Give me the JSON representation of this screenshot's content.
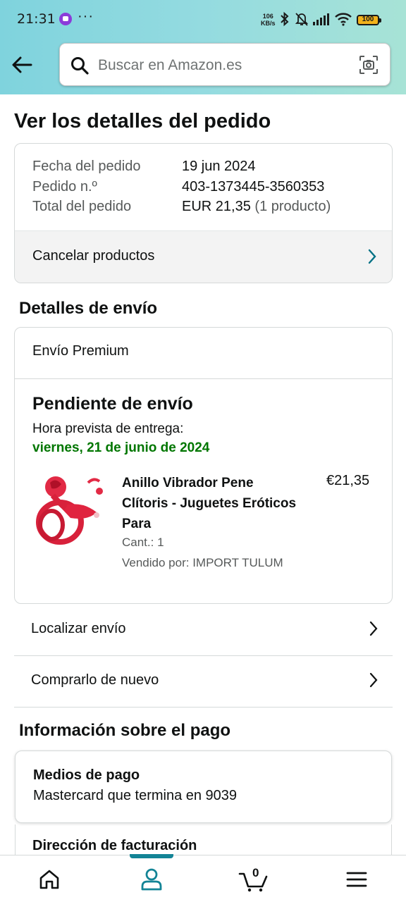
{
  "status_bar": {
    "time": "21:31",
    "more": "···",
    "speed_value": "106",
    "speed_unit": "KB/s",
    "battery": "100"
  },
  "search": {
    "placeholder": "Buscar en Amazon.es"
  },
  "page": {
    "title": "Ver los detalles del pedido"
  },
  "order": {
    "date_label": "Fecha del pedido",
    "date_value": "19 jun 2024",
    "number_label": "Pedido n.º",
    "number_value": "403-1373445-3560353",
    "total_label": "Total del pedido",
    "total_value": "EUR 21,35",
    "total_count": "(1 producto)",
    "cancel_label": "Cancelar productos"
  },
  "shipping": {
    "heading": "Detalles de envío",
    "type": "Envío Premium",
    "status": "Pendiente de envío",
    "eta_label": "Hora prevista de entrega:",
    "eta_date": "viernes, 21 de junio de 2024",
    "product": {
      "title": "Anillo Vibrador Pene Clítoris - Juguetes Eróticos Para",
      "price": "€21,35",
      "quantity": "Cant.: 1",
      "seller": "Vendido por: IMPORT TULUM"
    },
    "actions": [
      {
        "label": "Localizar envío"
      },
      {
        "label": "Comprarlo de nuevo"
      }
    ]
  },
  "payment": {
    "heading": "Información sobre el pago",
    "method_title": "Medios de pago",
    "method_value": "Mastercard  que termina en 9039",
    "billing_title": "Dirección de facturación"
  },
  "bottom_nav": {
    "cart_count": "0",
    "items": [
      "home-icon",
      "account-icon",
      "cart-icon",
      "menu-icon"
    ],
    "active": "account-icon"
  },
  "colors": {
    "header_gradient_start": "#7fd3dd",
    "header_gradient_end": "#a7e3d6",
    "delivery_green": "#007600",
    "active_teal": "#138496",
    "chevron_teal": "#007185"
  }
}
